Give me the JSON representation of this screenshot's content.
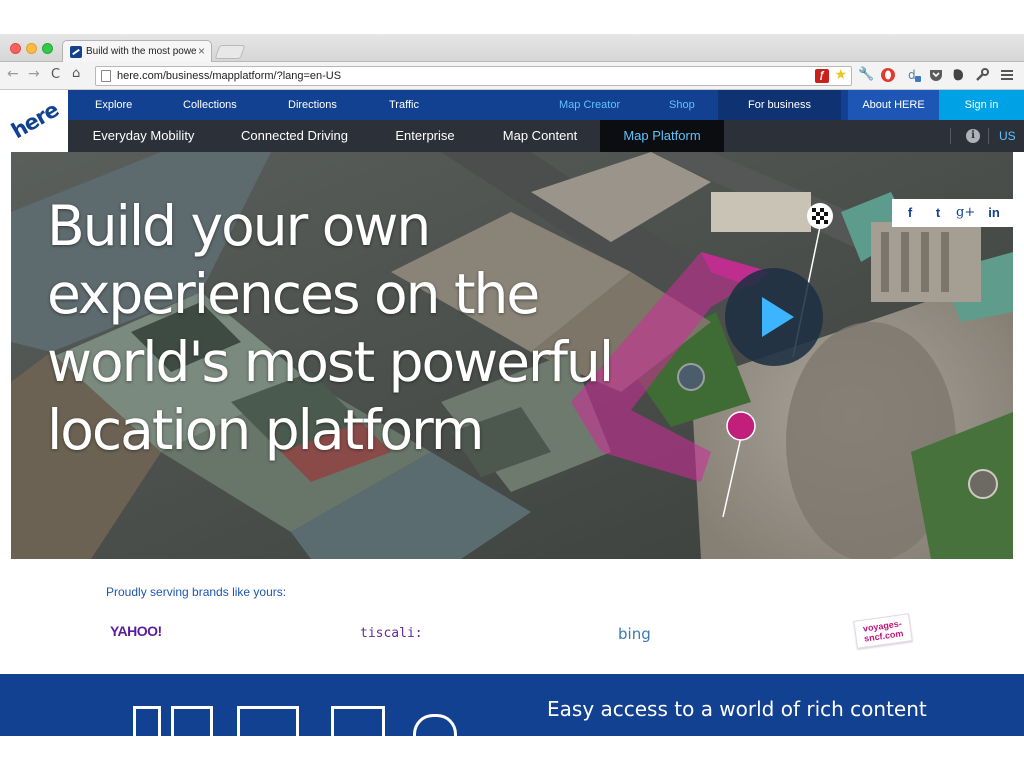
{
  "browser": {
    "tab_title": "Build with the most powerf",
    "tab_close": "×",
    "url": "here.com/business/mapplatform/?lang=en-US",
    "nav_icons": [
      "back-arrow-icon",
      "forward-arrow-icon",
      "reload-icon",
      "home-icon"
    ],
    "extension_icons": [
      "flash-icon",
      "star-icon",
      "wrench-icon",
      "opera-icon",
      "extension-icon",
      "pocket-icon",
      "evernote-icon",
      "settings-wrench-icon",
      "menu-icon"
    ]
  },
  "site": {
    "logo": "here",
    "top_nav": {
      "explore": "Explore",
      "collections": "Collections",
      "directions": "Directions",
      "traffic": "Traffic",
      "map_creator": "Map Creator",
      "shop": "Shop",
      "for_business": "For business",
      "about_here": "About HERE",
      "sign_in": "Sign in"
    },
    "sub_nav": {
      "everyday_mobility": "Everyday Mobility",
      "connected_driving": "Connected Driving",
      "enterprise": "Enterprise",
      "map_content": "Map Content",
      "map_platform": "Map Platform",
      "region": "US",
      "info_glyph": "i"
    },
    "hero": {
      "line1": "Build your own",
      "line2": "experiences on the",
      "line3": "world's most powerful",
      "line4": "location platform",
      "share": {
        "facebook": "f",
        "twitter": "t",
        "googleplus": "g+",
        "linkedin": "in"
      }
    },
    "brands": {
      "label": "Proudly serving brands like yours:",
      "yahoo": "YAHOO!",
      "tiscali": "tiscali:",
      "bing": "bing",
      "voyages_line1": "voyages-",
      "voyages_line2": "sncf.com"
    },
    "band": {
      "title": "Easy access to a world of rich content"
    }
  },
  "colors": {
    "here_blue": "#124191",
    "subnav_dark": "#2c3139",
    "accent_cyan": "#00a2e6",
    "route_magenta": "#d12a9a"
  }
}
